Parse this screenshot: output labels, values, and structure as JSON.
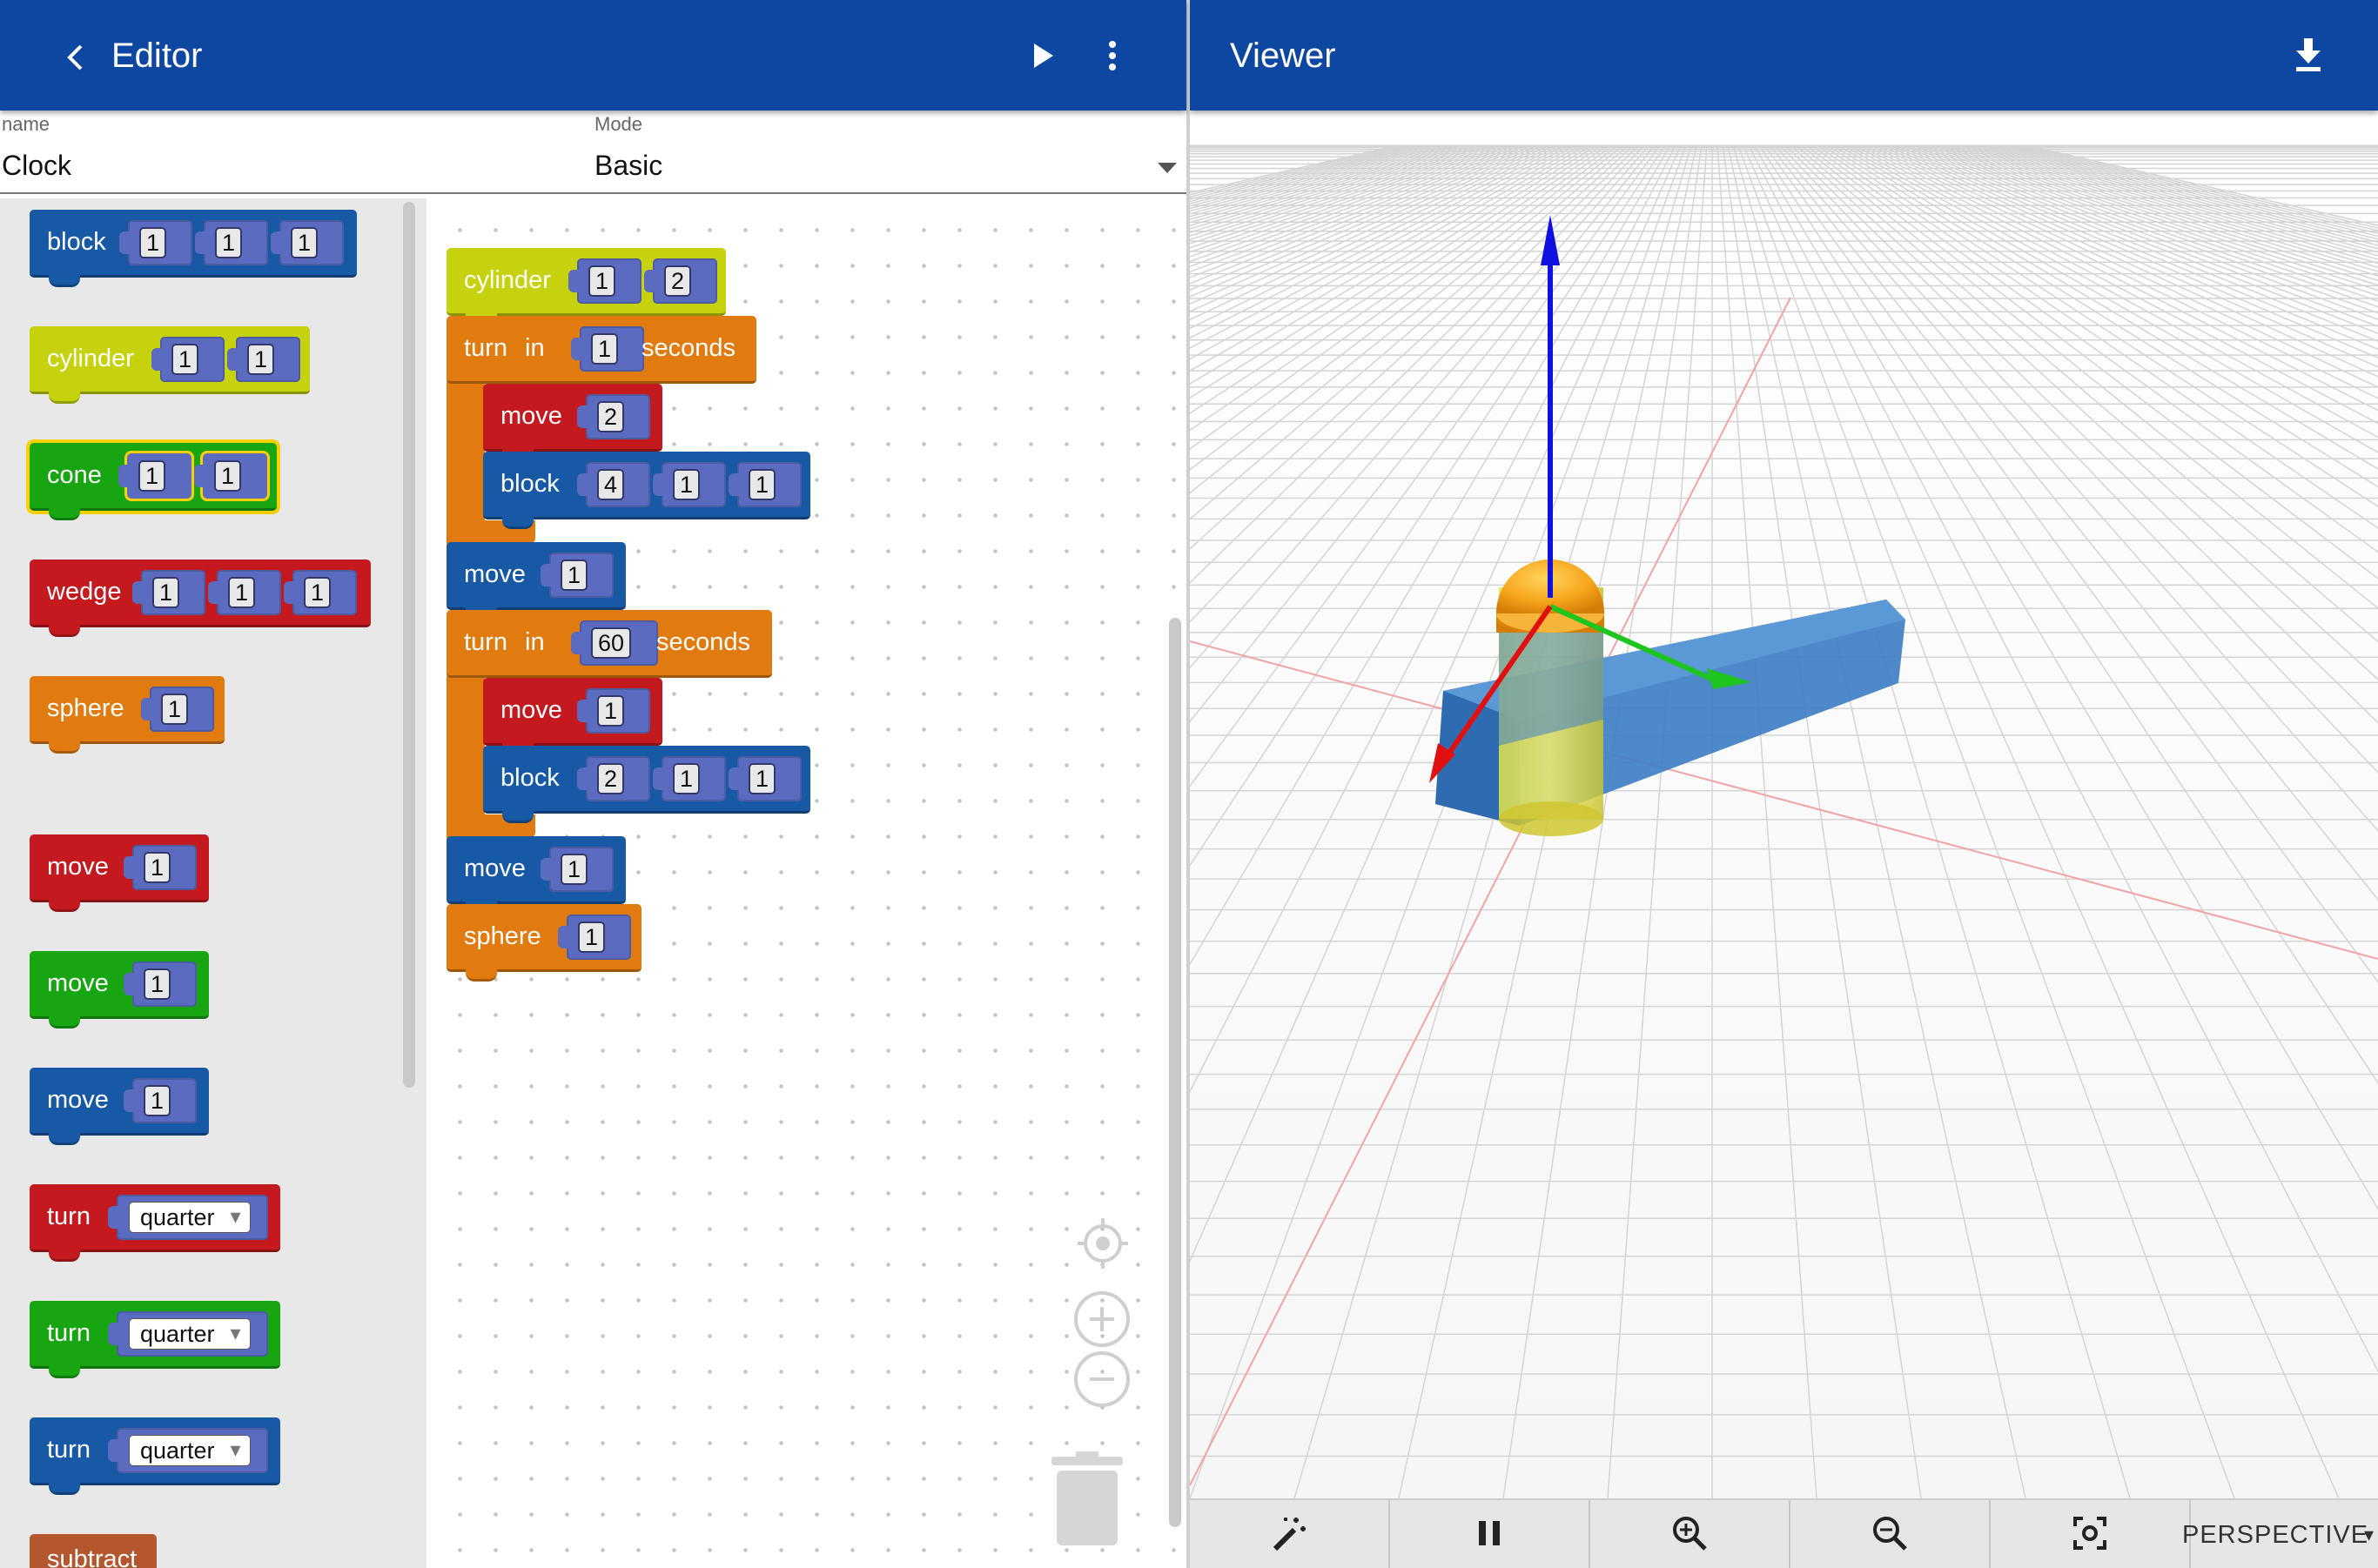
{
  "editor": {
    "title": "Editor",
    "name_label": "name",
    "name_value": "Clock",
    "mode_label": "Mode",
    "mode_value": "Basic",
    "icons": [
      "back-arrow-icon",
      "play-icon",
      "more-vert-icon"
    ]
  },
  "toolbox": {
    "blocks": [
      {
        "label": "block",
        "inputs": [
          "1",
          "1",
          "1"
        ],
        "color": "#1859a6"
      },
      {
        "label": "cylinder",
        "inputs": [
          "1",
          "1"
        ],
        "color": "#c5d20d"
      },
      {
        "label": "cone",
        "inputs": [
          "1",
          "1"
        ],
        "color": "#17a512"
      },
      {
        "label": "wedge",
        "inputs": [
          "1",
          "1",
          "1"
        ],
        "color": "#c41a1f"
      },
      {
        "label": "sphere",
        "inputs": [
          "1"
        ],
        "color": "#e17b0f"
      },
      {
        "label": "move",
        "inputs": [
          "1"
        ],
        "color": "#c41a1f"
      },
      {
        "label": "move",
        "inputs": [
          "1"
        ],
        "color": "#17a512"
      },
      {
        "label": "move",
        "inputs": [
          "1"
        ],
        "color": "#1859a6"
      },
      {
        "label": "turn",
        "dropdown": "quarter",
        "color": "#c41a1f"
      },
      {
        "label": "turn",
        "dropdown": "quarter",
        "color": "#17a512"
      },
      {
        "label": "turn",
        "dropdown": "quarter",
        "color": "#1859a6"
      },
      {
        "label": "subtract",
        "color": "#b3572e"
      }
    ]
  },
  "workspace": {
    "cylinder": {
      "label": "cylinder",
      "inputs": [
        "1",
        "2"
      ]
    },
    "turn1": {
      "label": "turn",
      "in": "in",
      "value": "1",
      "unit": "seconds"
    },
    "turn1_move": {
      "label": "move",
      "value": "2"
    },
    "turn1_block": {
      "label": "block",
      "inputs": [
        "4",
        "1",
        "1"
      ]
    },
    "move1": {
      "label": "move",
      "value": "1"
    },
    "turn2": {
      "label": "turn",
      "in": "in",
      "value": "60",
      "unit": "seconds"
    },
    "turn2_move": {
      "label": "move",
      "value": "1"
    },
    "turn2_block": {
      "label": "block",
      "inputs": [
        "2",
        "1",
        "1"
      ]
    },
    "move2": {
      "label": "move",
      "value": "1"
    },
    "sphere": {
      "label": "sphere",
      "value": "1"
    }
  },
  "viewer": {
    "title": "Viewer",
    "icons": [
      "download-icon",
      "magic-wand-icon",
      "pause-icon",
      "zoom-in-icon",
      "zoom-out-icon",
      "center-focus-icon"
    ],
    "camera_mode": "PERSPECTIVE"
  }
}
